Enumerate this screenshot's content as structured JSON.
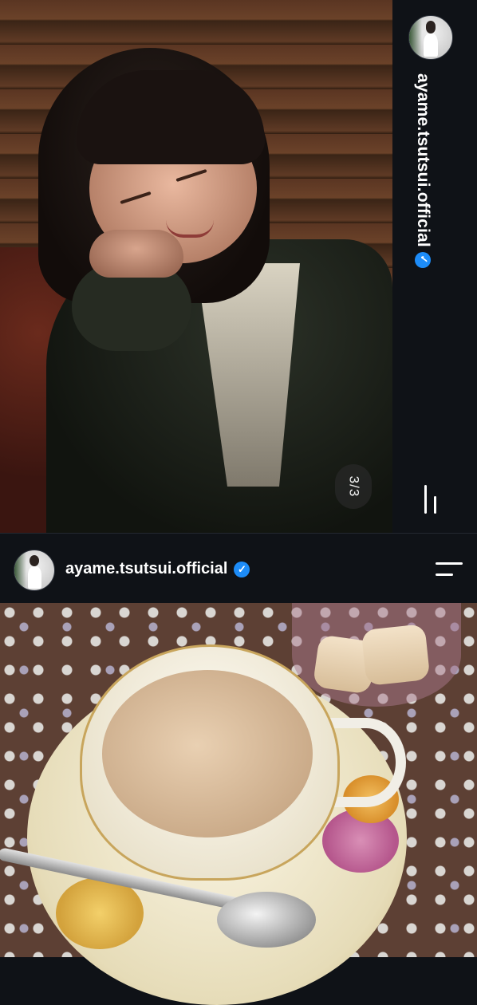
{
  "top_post": {
    "username": "ayame.tsutsui.official",
    "verified_icon": "verified-badge-icon",
    "photo_counter": "3/3",
    "menu_icon": "menu-icon"
  },
  "bottom_post": {
    "username": "ayame.tsutsui.official",
    "verified_icon": "verified-badge-icon",
    "menu_icon": "menu-icon"
  },
  "colors": {
    "background": "#0f1217",
    "verified": "#1d8cf8",
    "text": "#ffffff"
  }
}
